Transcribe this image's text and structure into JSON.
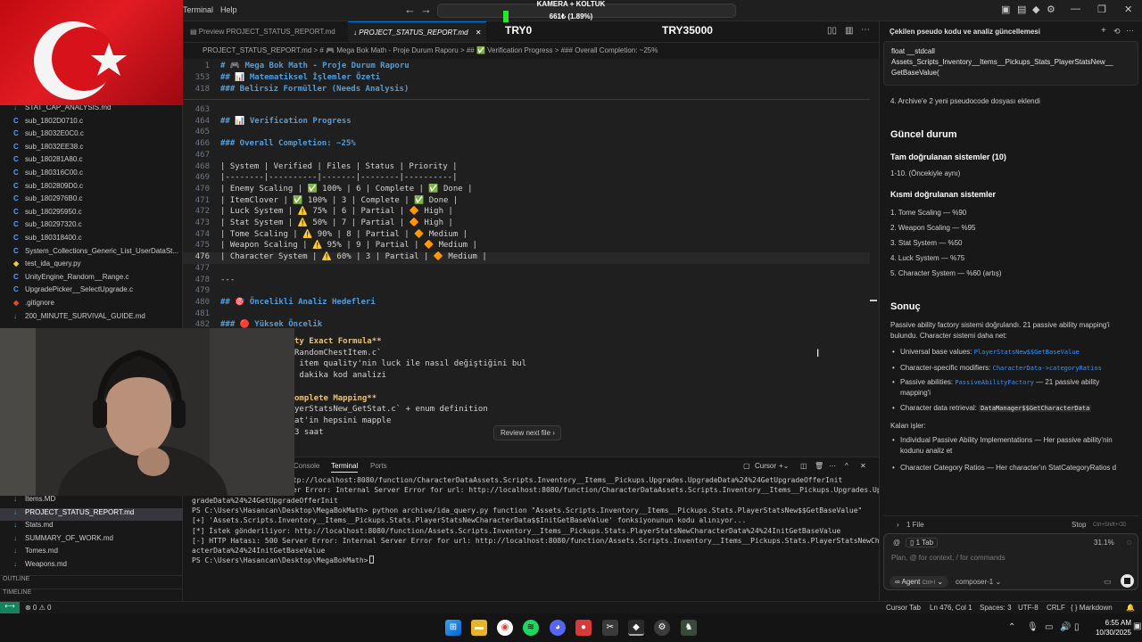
{
  "titlebar": {
    "menu": [
      "Terminal",
      "Help"
    ],
    "back_icon": "arrow-left-icon",
    "forward_icon": "arrow-right-icon"
  },
  "stream_overlay": {
    "camera_label": "KAMERA + KOLTUK",
    "progress_text": "661₺ (1.89%)",
    "try_left": "TRY0",
    "try_right": "TRY35000",
    "progress_fraction": 0.0189
  },
  "sidebar": {
    "files": [
      {
        "icon": "md",
        "name": "STAT_CAP_ANALYSIS.md"
      },
      {
        "icon": "C",
        "name": "sub_1802D0710.c"
      },
      {
        "icon": "C",
        "name": "sub_18032E0C0.c"
      },
      {
        "icon": "C",
        "name": "sub_18032EE38.c"
      },
      {
        "icon": "C",
        "name": "sub_180281A80.c"
      },
      {
        "icon": "C",
        "name": "sub_180316C00.c"
      },
      {
        "icon": "C",
        "name": "sub_1802809D0.c"
      },
      {
        "icon": "C",
        "name": "sub_1802976B0.c"
      },
      {
        "icon": "C",
        "name": "sub_180295950.c"
      },
      {
        "icon": "C",
        "name": "sub_180297320.c"
      },
      {
        "icon": "C",
        "name": "sub_180318400.c"
      },
      {
        "icon": "C",
        "name": "System_Collections_Generic_List_UserDataSt..."
      },
      {
        "icon": "py",
        "name": "test_ida_query.py"
      },
      {
        "icon": "C",
        "name": "UnityEngine_Random__Range.c"
      },
      {
        "icon": "C",
        "name": "UpgradePicker__SelectUpgrade.c"
      },
      {
        "icon": "git",
        "name": ".gitignore"
      },
      {
        "icon": "md",
        "name": "200_MINUTE_SURVIVAL_GUIDE.md"
      }
    ],
    "files_bottom": [
      {
        "icon": "md",
        "name": "Items.MD"
      },
      {
        "icon": "md",
        "name": "PROJECT_STATUS_REPORT.md",
        "active": true
      },
      {
        "icon": "md",
        "name": "Stats.md"
      },
      {
        "icon": "md",
        "name": "SUMMARY_OF_WORK.md"
      },
      {
        "icon": "md",
        "name": "Tomes.md"
      },
      {
        "icon": "md",
        "name": "Weapons.md"
      }
    ],
    "outline_label": "OUTLINE",
    "timeline_label": "TIMELINE"
  },
  "tabs": [
    {
      "label": "Preview PROJECT_STATUS_REPORT.md"
    },
    {
      "label": "PROJECT_STATUS_REPORT.md"
    }
  ],
  "breadcrumb": "PROJECT_STATUS_REPORT.md > # 🎮 Mega Bok Math - Proje Durum Raporu > ## ✅ Verification Progress > ### Overall Completion: ~25%",
  "editor": {
    "sticky": [
      {
        "no": "1",
        "text": "# 🎮 Mega Bok Math - Proje Durum Raporu"
      },
      {
        "no": "353",
        "text": "## 📊 Matematiksel İşlemler Özeti"
      },
      {
        "no": "418",
        "text": "### Belirsiz Formüller (Needs Analysis)"
      }
    ],
    "lines": [
      {
        "no": "463",
        "text": ""
      },
      {
        "no": "464",
        "text": "## 📊 Verification Progress"
      },
      {
        "no": "465",
        "text": ""
      },
      {
        "no": "466",
        "text": "### Overall Completion: ~25%"
      },
      {
        "no": "467",
        "text": ""
      },
      {
        "no": "468",
        "text": "| System | Verified | Files | Status | Priority |"
      },
      {
        "no": "469",
        "text": "|--------|----------|-------|--------|----------|"
      },
      {
        "no": "470",
        "text": "| Enemy Scaling | ✅ 100% | 6 | Complete | ✅ Done |"
      },
      {
        "no": "471",
        "text": "| ItemClover | ✅ 100% | 3 | Complete | ✅ Done |"
      },
      {
        "no": "472",
        "text": "| Luck System | ⚠️ 75% | 6 | Partial | 🔶 High |"
      },
      {
        "no": "473",
        "text": "| Stat System | ⚠️ 50% | 7 | Partial | 🔶 High |"
      },
      {
        "no": "474",
        "text": "| Tome Scaling | ⚠️ 90% | 8 | Partial | 🔶 Medium |"
      },
      {
        "no": "475",
        "text": "| Weapon Scaling | ⚠️ 95% | 9 | Partial | 🔶 Medium |"
      },
      {
        "no": "476",
        "text": "| Character System | ⚠️ 60% | 3 | Partial | 🔶 Medium |",
        "current": true
      },
      {
        "no": "477",
        "text": ""
      },
      {
        "no": "478",
        "text": "---"
      },
      {
        "no": "479",
        "text": ""
      },
      {
        "no": "480",
        "text": "## 🎯 Öncelikli Analiz Hedefleri"
      },
      {
        "no": "481",
        "text": ""
      },
      {
        "no": "482",
        "text": "### 🔴 Yüksek Öncelik"
      }
    ],
    "partial_lines": [
      "ty Exact Formula**",
      "RandomChestItem.c`",
      " item quality'nin luck ile nasıl değiştiğini bul",
      " dakika kod analizi",
      "",
      "omplete Mapping**",
      "yerStatsNew_GetStat.c` + enum definition",
      "at'in hepsini mapple",
      "3 saat"
    ],
    "review_button": "Review next file"
  },
  "panel": {
    "tabs": [
      "Console",
      "Terminal",
      "Ports"
    ],
    "terminal_name": "Cursor",
    "lines": [
      "ttp://localhost:8080/function/CharacterDataAssets.Scripts.Inventory__Items__Pickups.Upgrades.UpgradeData%24%24GetUpgradeOfferInit",
      "ver Error: Internal Server Error for url: http://localhost:8080/function/CharacterDataAssets.Scripts.Inventory__Items__Pickups.Upgrades.Up",
      "gradeData%24%24GetUpgradeOfferInit",
      "PS C:\\Users\\Hasancan\\Desktop\\MegaBokMath> python archive/ida_query.py function \"Assets.Scripts.Inventory__Items__Pickups.Stats.PlayerStatsNew$$GetBaseValue\"",
      "[+] 'Assets.Scripts.Inventory__Items__Pickups.Stats.PlayerStatsNewCharacterData$$InitGetBaseValue' fonksiyonunun kodu alınıyor...",
      "[*] İstek gönderiliyor: http://localhost:8080/function/Assets.Scripts.Inventory__Items__Pickups.Stats.PlayerStatsNewCharacterData%24%24InitGetBaseValue",
      "[-] HTTP Hatası: 500 Server Error: Internal Server Error for url: http://localhost:8080/function/Assets.Scripts.Inventory__Items__Pickups.Stats.PlayerStatsNewChar",
      "acterData%24%24InitGetBaseValue",
      "PS C:\\Users\\Hasancan\\Desktop\\MegaBokMath> "
    ]
  },
  "chat": {
    "title": "Çekilen pseudo kodu ve analiz güncellemesi",
    "func_box": [
      "float __stdcall",
      "Assets_Scripts_Inventory__Items__Pickups_Stats_PlayerStatsNew__",
      "GetBaseValue("
    ],
    "item4": "4. Archive'e 2 yeni pseudocode dosyası eklendi",
    "h_current": "Güncel durum",
    "h_full": "Tam doğrulanan sistemler (10)",
    "full_text": "1-10. (Öncekiyle aynı)",
    "h_partial": "Kısmi doğrulanan sistemler",
    "partial": [
      "1. Tome Scaling — %90",
      "2. Weapon Scaling — %95",
      "3. Stat System — %50",
      "4. Luck System — %75",
      "5. Character System — %60 (artış)"
    ],
    "h_result": "Sonuç",
    "result_1": "Passive ability factory sistemi doğrulandı. 21 passive ability mapping'i",
    "result_2": "bulundu. Character sistemi daha net:",
    "bullets": [
      {
        "label": "Universal base values:",
        "code": "PlayerStatsNew$$GetBaseValue"
      },
      {
        "label": "Character-specific modifiers:",
        "code": "CharacterData->categoryRatios"
      },
      {
        "label": "Passive abilities:",
        "code": "PassiveAbilityFactory",
        "after": " — 21 passive ability",
        "cont": "mapping'i"
      },
      {
        "label": "Character data retrieval:",
        "code": "DataManager$$GetCharacterData"
      }
    ],
    "remaining": "Kalan işler:",
    "tasks": [
      {
        "text": "Individual Passive Ability Implementations — Her passive ability'nin",
        "cont": "kodunu analiz et"
      },
      {
        "text": "Character Category Ratios — Her character'ın StatCategoryRatios d",
        "cont": ""
      }
    ],
    "files_count": "1 File",
    "stop_label": "Stop",
    "stop_shortcut": "Ctrl+Shift+⌫",
    "tab_chip": "1 Tab",
    "context_percent": "31.1%",
    "input_placeholder": "Plan, @ for context, / for commands",
    "agent_label": "Agent",
    "agent_shortcut": "Ctrl+I",
    "model_label": "composer-1"
  },
  "statusbar": {
    "remote": "⟷",
    "problems": "⊗ 0 ⚠ 0",
    "cursor_tab": "Cursor Tab",
    "position": "Ln 476, Col 1",
    "spaces": "Spaces: 3",
    "encoding": "UTF-8",
    "eol": "CRLF",
    "language": "{ } Markdown"
  },
  "taskbar": {
    "time": "6:55 AM",
    "date": "10/30/2025"
  }
}
